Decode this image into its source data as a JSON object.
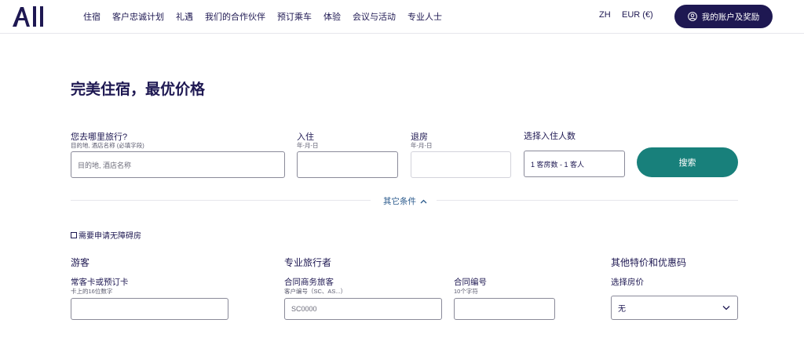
{
  "header": {
    "nav": [
      "住宿",
      "客户忠诚计划",
      "礼遇",
      "我们的合作伙伴",
      "预订乘车",
      "体验",
      "会议与活动",
      "专业人士"
    ],
    "lang": "ZH",
    "currency": "EUR (€)",
    "account_label": "我的账户及奖励"
  },
  "page_title": "完美住宿，最优价格",
  "search": {
    "destination_label": "您去哪里旅行?",
    "destination_sublabel": "目的地, 酒店名称 (必填字段)",
    "destination_placeholder": "目的地, 酒店名称",
    "checkin_label": "入住",
    "checkin_sublabel": "年-月-日",
    "checkout_label": "退房",
    "checkout_sublabel": "年-月-日",
    "guests_label": "选择入住人数",
    "guests_value": "1 客房数 - 1 客人",
    "search_label": "搜索"
  },
  "more_criteria": "其它条件",
  "accessible_label": "需要申请无障碍房",
  "sections": {
    "guest_title": "游客",
    "card_label": "常客卡或预订卡",
    "card_sublabel": "卡上的16位数字",
    "pro_title": "专业旅行者",
    "contract_label": "合同商务旅客",
    "contract_sublabel": "客户编号（SC、AS...）",
    "contract_placeholder": "SC0000",
    "contract_no_label": "合同编号",
    "contract_no_sublabel": "10个字符",
    "offers_title": "其他特价和优惠码",
    "rate_label": "选择房价",
    "rate_value": "无"
  }
}
